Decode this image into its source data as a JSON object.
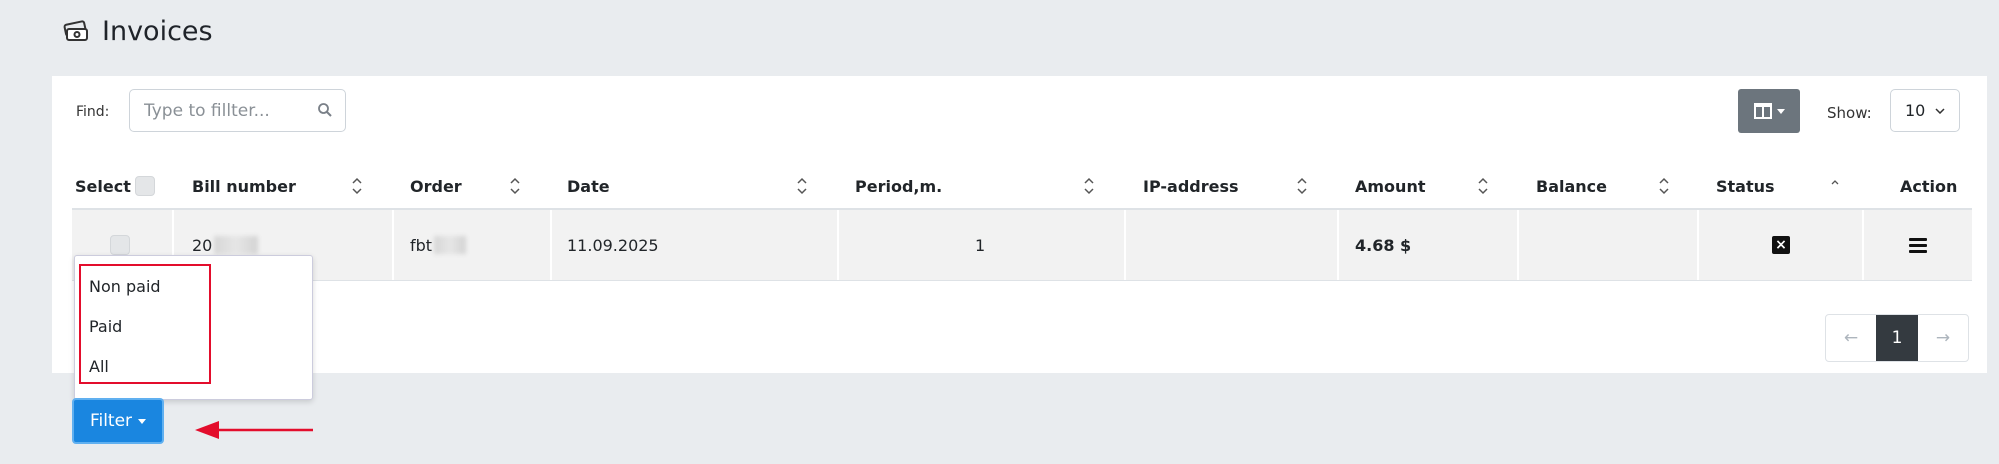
{
  "page": {
    "title": "Invoices",
    "title_icon": "money-stack-icon"
  },
  "toolbar": {
    "find_label": "Find:",
    "search_placeholder": "Type to fillter...",
    "search_icon": "search-icon",
    "columns_icon": "columns-icon",
    "show_label": "Show:",
    "show_value": "10"
  },
  "table": {
    "headers": [
      "Select",
      "Bill number",
      "Order",
      "Date",
      "Period,m.",
      "IP-address",
      "Amount",
      "Balance",
      "Status",
      "Action"
    ],
    "rows": [
      {
        "bill_number": "20",
        "order": "fbt",
        "date": "11.09.2025",
        "period": "1",
        "ip": "",
        "amount": "4.68 $",
        "balance": "",
        "status_icon": "x-square-icon",
        "action_icon": "menu-icon"
      }
    ]
  },
  "pagination": {
    "prev": "←",
    "current": "1",
    "next": "→"
  },
  "filter_menu": {
    "options": [
      "Non paid",
      "Paid",
      "All"
    ]
  },
  "filter_button": {
    "label": "Filter"
  },
  "colors": {
    "accent": "#1a86e0",
    "highlight": "#e30d2c",
    "pager_active": "#343a40"
  }
}
